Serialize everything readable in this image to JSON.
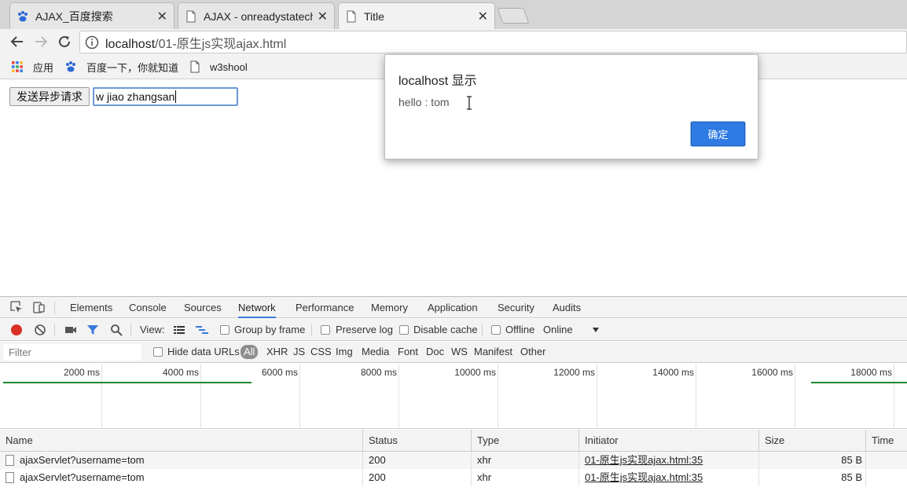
{
  "browser": {
    "tabs": [
      {
        "title": "AJAX_百度搜索",
        "icon": "baidu-paw-icon"
      },
      {
        "title": "AJAX - onreadystatecha",
        "icon": "page-icon"
      },
      {
        "title": "Title",
        "icon": "page-icon"
      }
    ],
    "tab_close": "✕",
    "address": {
      "host": "localhost",
      "path": "/01-原生js实现ajax.html"
    },
    "bookmarks": [
      {
        "label": "应用",
        "icon": "apps-grid-icon"
      },
      {
        "label": "百度一下，你就知道",
        "icon": "baidu-paw-icon"
      },
      {
        "label": "w3shool",
        "icon": "page-icon"
      }
    ]
  },
  "page": {
    "send_button": "发送异步请求",
    "input_value": "w jiao zhangsan"
  },
  "dialog": {
    "title": "localhost 显示",
    "message": "hello : tom",
    "ok": "确定"
  },
  "devtools": {
    "tabs": [
      "Elements",
      "Console",
      "Sources",
      "Network",
      "Performance",
      "Memory",
      "Application",
      "Security",
      "Audits"
    ],
    "active_tab": "Network",
    "toolbar": {
      "view_label": "View:",
      "group_by_frame": "Group by frame",
      "preserve_log": "Preserve log",
      "disable_cache": "Disable cache",
      "offline": "Offline",
      "throttle": "Online"
    },
    "filter": {
      "placeholder": "Filter",
      "hide_data_urls": "Hide data URLs",
      "types": [
        "All",
        "XHR",
        "JS",
        "CSS",
        "Img",
        "Media",
        "Font",
        "Doc",
        "WS",
        "Manifest",
        "Other"
      ]
    },
    "timeline_ticks": [
      "2000 ms",
      "4000 ms",
      "6000 ms",
      "8000 ms",
      "10000 ms",
      "12000 ms",
      "14000 ms",
      "16000 ms",
      "18000 ms"
    ],
    "columns": [
      "Name",
      "Status",
      "Type",
      "Initiator",
      "Size",
      "Time"
    ],
    "rows": [
      {
        "name": "ajaxServlet?username=tom",
        "status": "200",
        "type": "xhr",
        "initiator": "01-原生js实现ajax.html:35",
        "size": "85 B",
        "time": ""
      },
      {
        "name": "ajaxServlet?username=tom",
        "status": "200",
        "type": "xhr",
        "initiator": "01-原生js实现ajax.html:35",
        "size": "85 B",
        "time": ""
      }
    ]
  },
  "colors": {
    "accent": "#3879d9",
    "record": "#d93025",
    "ok_button": "#2f7be3",
    "waterfall": "#1a8a2e"
  }
}
